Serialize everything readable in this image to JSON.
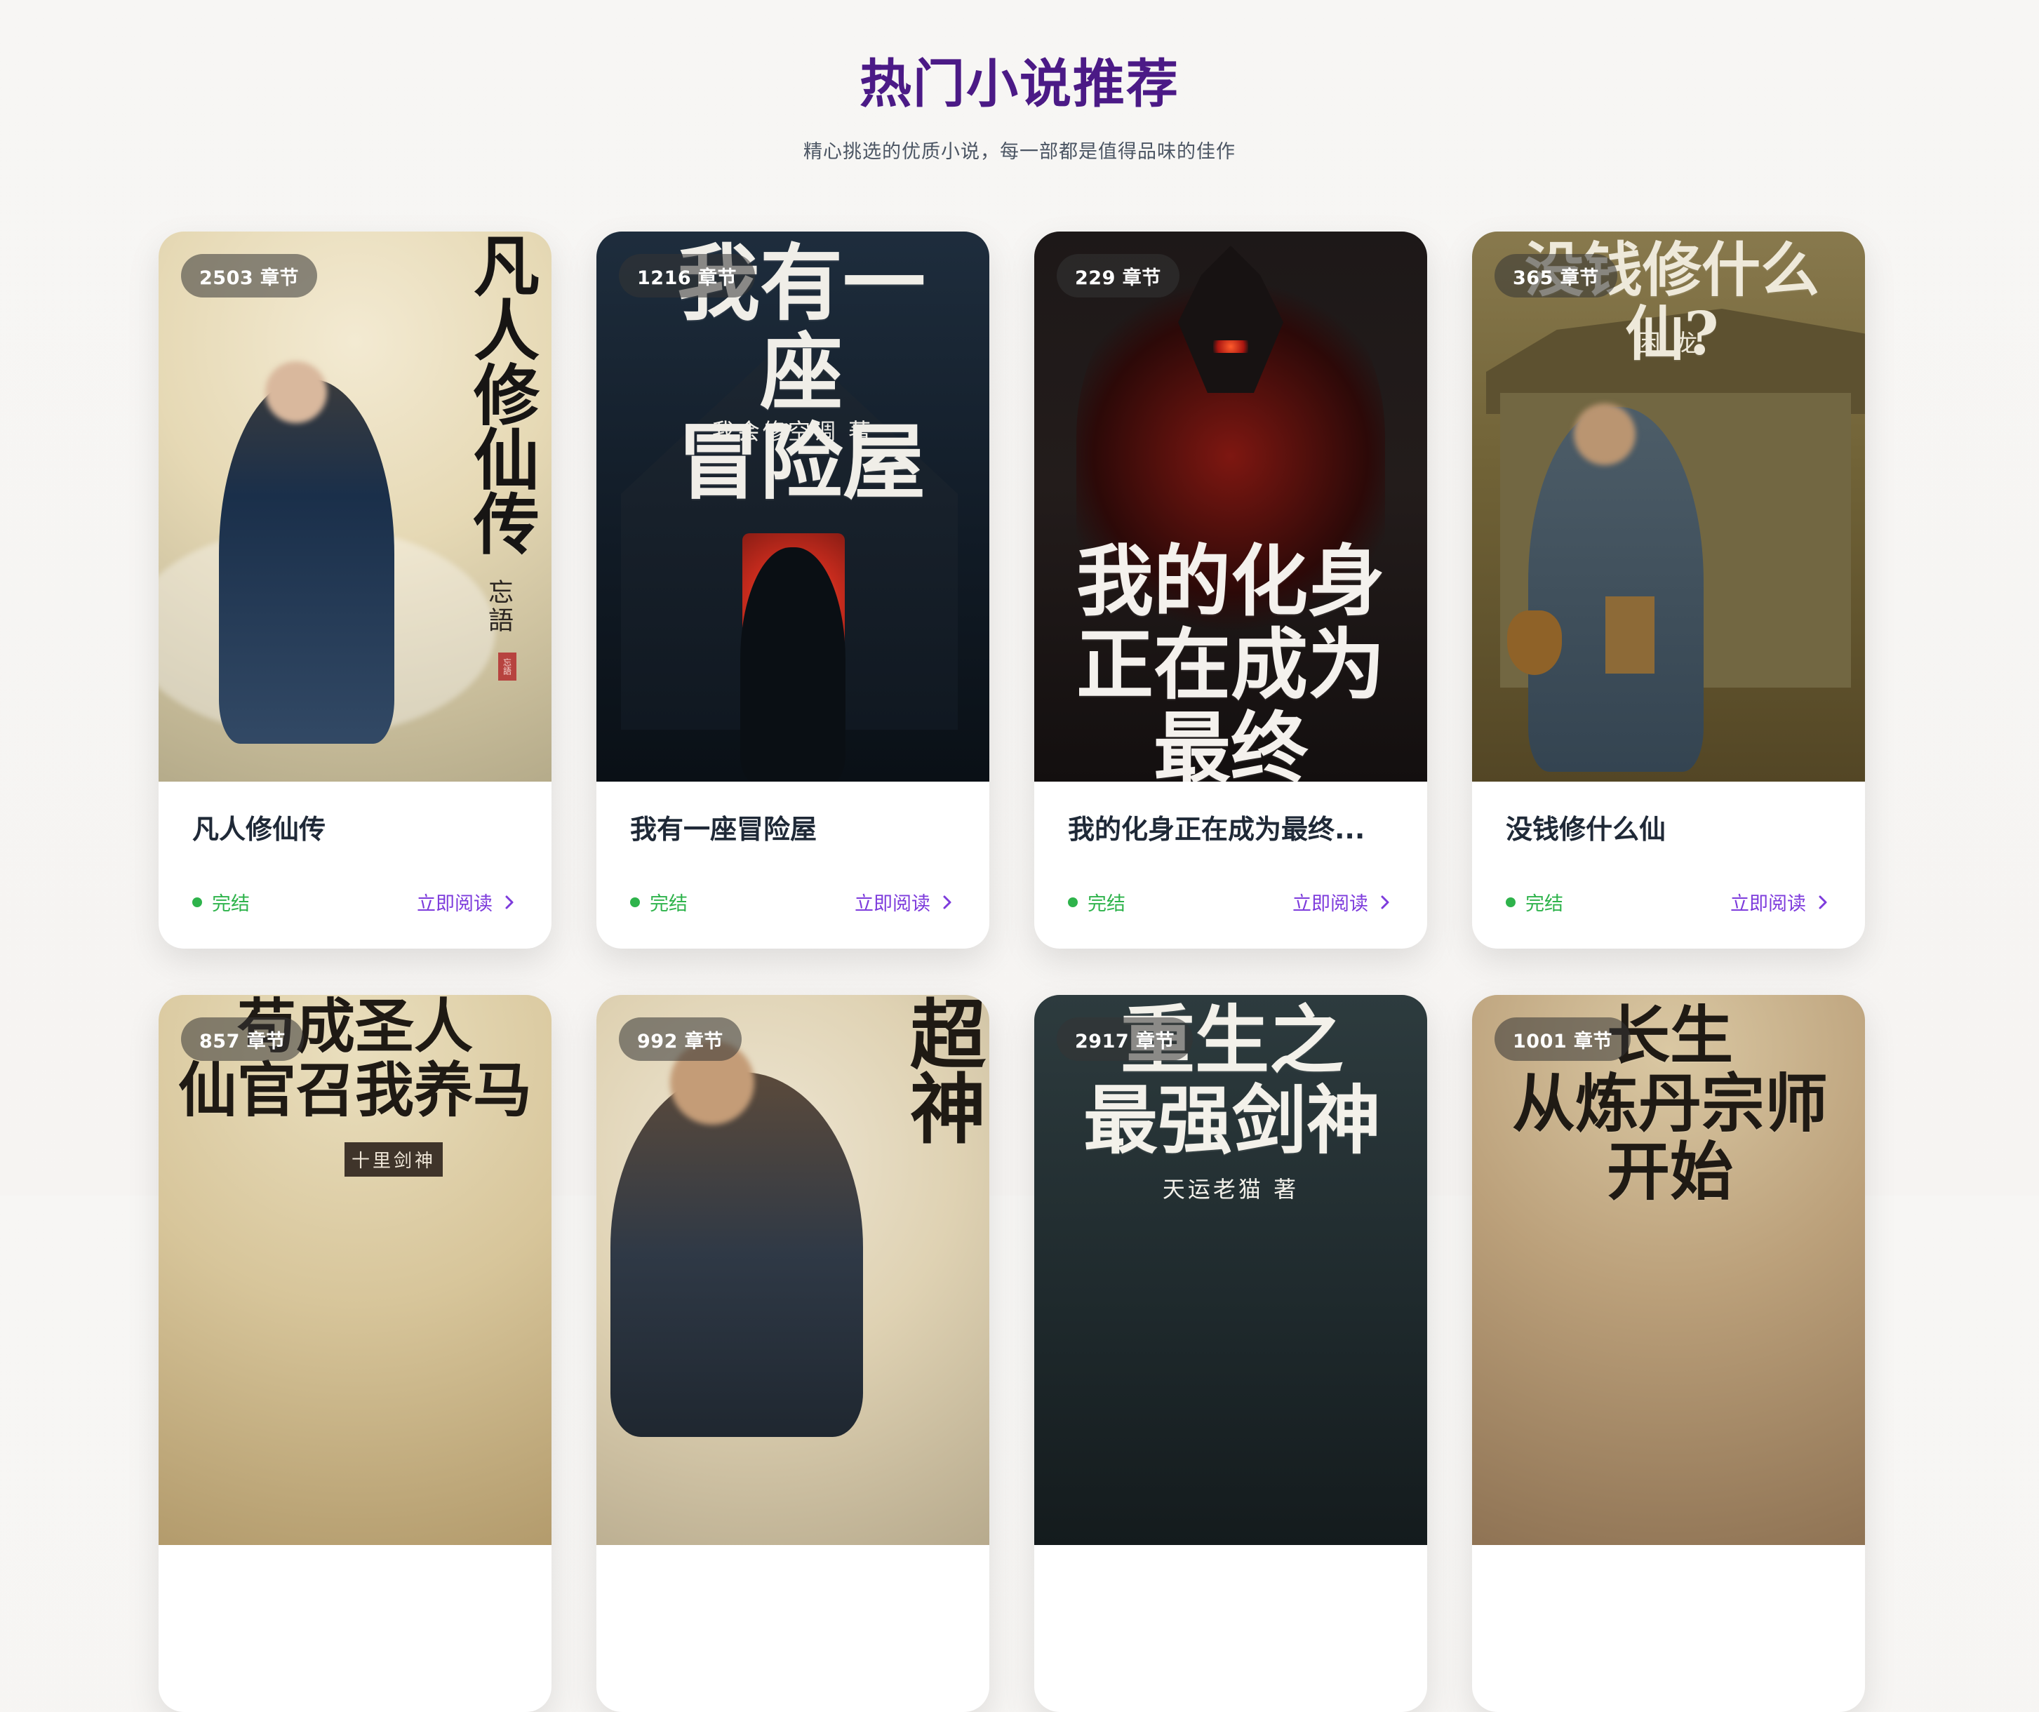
{
  "header": {
    "title": "热门小说推荐",
    "subtitle": "精心挑选的优质小说，每一部都是值得品味的佳作"
  },
  "cards": [
    {
      "chapter_count": "2503 章节",
      "title": "凡人修仙传",
      "status": "完结",
      "read_label": "立即阅读",
      "cover_title": "凡人修仙传",
      "cover_author": "忘語",
      "cover_seal": "忘語"
    },
    {
      "chapter_count": "1216 章节",
      "title": "我有一座冒险屋",
      "status": "完结",
      "read_label": "立即阅读",
      "cover_title": "我有一座\n冒险屋",
      "cover_author": "我会修空调 著"
    },
    {
      "chapter_count": "229 章节",
      "title": "我的化身正在成为最终...",
      "status": "完结",
      "read_label": "立即阅读",
      "cover_title": "我的化身\n正在成为\n最终BOSS",
      "cover_author": ""
    },
    {
      "chapter_count": "365 章节",
      "title": "没钱修什么仙",
      "status": "完结",
      "read_label": "立即阅读",
      "cover_title": "没钱修什么仙?",
      "cover_author": "困 龙"
    },
    {
      "chapter_count": "857 章节",
      "title": "",
      "status": "",
      "read_label": "",
      "cover_title": "苟成圣人\n仙官召我养马",
      "cover_author": "十里剑神"
    },
    {
      "chapter_count": "992 章节",
      "title": "",
      "status": "",
      "read_label": "",
      "cover_title": "超神",
      "cover_author": ""
    },
    {
      "chapter_count": "2917 章节",
      "title": "",
      "status": "",
      "read_label": "",
      "cover_title": "重生之\n最强剑神",
      "cover_author": "天运老猫 著"
    },
    {
      "chapter_count": "1001 章节",
      "title": "",
      "status": "",
      "read_label": "",
      "cover_title": "长生\n从炼丹宗师\n开始",
      "cover_author": ""
    }
  ],
  "colors": {
    "accent": "#7d3bdc",
    "title": "#4b1a86",
    "status": "#2eb34b"
  },
  "icons": {
    "read_more": "chevron-right-icon",
    "status": "status-dot-icon"
  }
}
